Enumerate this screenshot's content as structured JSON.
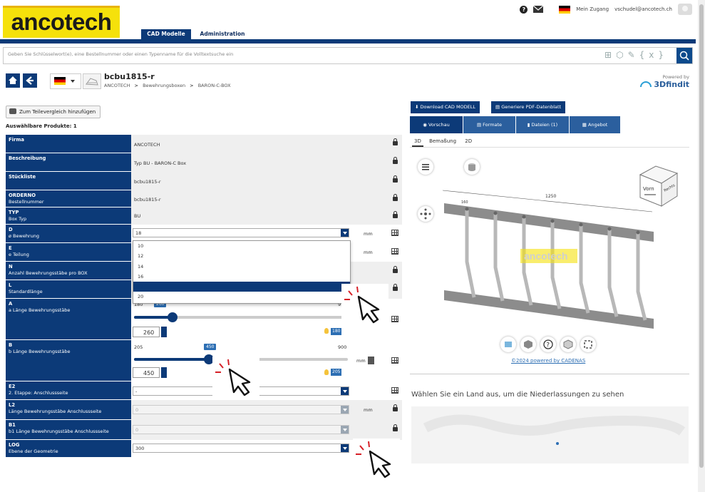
{
  "brand": {
    "logo_text": "ancotech",
    "accent": "#0c3a78",
    "logo_bg": "#f5e10b"
  },
  "topbar": {
    "help_icon": "question-icon",
    "mail_icon": "mail-icon",
    "account": "Mein Zugang",
    "email": "vschudel@ancotech.ch"
  },
  "nav": {
    "tabs": [
      {
        "label": "CAD Modelle"
      },
      {
        "label": "Administration"
      }
    ]
  },
  "search": {
    "placeholder": "Geben Sie Schlüsselwort(e), eine Bestellnummer oder einen Typenname für die Volltextsuche ein"
  },
  "product": {
    "title": "bcbu1815-r",
    "breadcrumb": [
      "ANCOTECH",
      "Bewehrungsboxen",
      "BARON-C-BOX"
    ],
    "powered_by": "Powered by",
    "powered_brand": "3Dfindit"
  },
  "compare_button": "Zum Teilevergleich hinzufügen",
  "available_products": "Auswählbare Produkte: 1",
  "fields": {
    "firma": {
      "label": "Firma",
      "value": "ANCOTECH"
    },
    "beschreibung": {
      "label": "Beschreibung",
      "value": "Typ BU - BARON-C Box"
    },
    "stueckliste": {
      "label": "Stückliste",
      "value": "bcbu1815-r"
    },
    "orderno": {
      "label": "ORDERNO",
      "sub": "Bestellnummer",
      "value": "bcbu1815-r"
    },
    "typ": {
      "label": "TYP",
      "sub": "Box Typ",
      "value": "BU"
    },
    "d": {
      "label": "D",
      "sub": "ø Bewehrung",
      "value": "18",
      "unit": "mm"
    },
    "e": {
      "label": "E",
      "sub": "e Teilung",
      "unit": "mm"
    },
    "n": {
      "label": "N",
      "sub": "Anzahl Bewehrungsstäbe pro BOX"
    },
    "l": {
      "label": "L",
      "sub": "Standardlänge"
    },
    "a": {
      "label": "A",
      "sub": "a Länge Bewehrungsstäbe",
      "min": "180",
      "current_tag": "260",
      "max": "9",
      "input": "260",
      "badge": "180"
    },
    "b": {
      "label": "B",
      "sub": "b Länge Bewehrungsstäbe",
      "min": "205",
      "current_tag": "450",
      "max": "900",
      "input": "450",
      "badge": "205",
      "unit": "mm"
    },
    "e2": {
      "label": "E2",
      "sub": "2. Etappe: Anschlussseite",
      "value": "-"
    },
    "l2": {
      "label": "L2",
      "sub": "Länge Bewehrungsstäbe Anschlussseite",
      "value": "0",
      "unit": "mm"
    },
    "b1": {
      "label": "B1",
      "sub": "b1 Länge Bewehrungsstäbe Anschlussseite",
      "value": "0"
    },
    "log": {
      "label": "LOG",
      "sub": "Ebene der Geometrie",
      "value": "300"
    }
  },
  "slider_a_fraction": 0.18,
  "slider_b_fraction": 0.35,
  "dropdown_options": [
    "10",
    "12",
    "14",
    "16",
    "18",
    "20"
  ],
  "actions": {
    "download": "Download CAD MODELL",
    "pdf": "Generiere PDF-Datenblatt"
  },
  "viewer_tabs": [
    {
      "label": "Vorschau"
    },
    {
      "label": "Formate"
    },
    {
      "label": "Dateien (1)"
    },
    {
      "label": "Angebot"
    }
  ],
  "sub_tabs": [
    "3D",
    "Bemaßung",
    "2D"
  ],
  "viewer": {
    "dimension": "1250",
    "dimension2": "160",
    "cube_front": "Vorn",
    "cube_right": "Rechts",
    "watermark": "ancotech",
    "copyright": "©2024 powered by CADENAS"
  },
  "map_prompt": "Wählen Sie ein Land aus, um die Niederlassungen zu sehen"
}
